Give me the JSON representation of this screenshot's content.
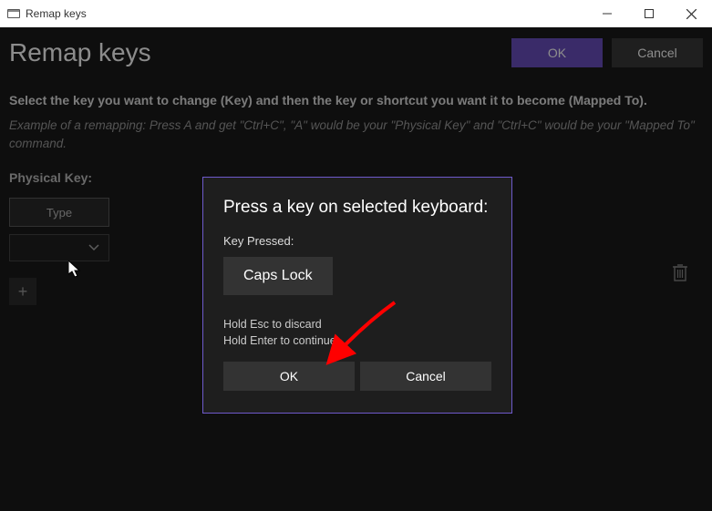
{
  "titlebar": {
    "title": "Remap keys"
  },
  "header": {
    "page_title": "Remap keys",
    "ok_label": "OK",
    "cancel_label": "Cancel"
  },
  "main": {
    "instruction": "Select the key you want to change (Key) and then the key or shortcut you want it to become (Mapped To).",
    "example": "Example of a remapping: Press A and get \"Ctrl+C\", \"A\" would be your \"Physical Key\" and \"Ctrl+C\" would be your \"Mapped To\" command.",
    "physical_key_label": "Physical Key:",
    "type_button_label": "Type",
    "select_value": "",
    "add_label": "+"
  },
  "modal": {
    "title": "Press a key on selected keyboard:",
    "key_pressed_label": "Key Pressed:",
    "key_pressed_value": "Caps Lock",
    "hint_line1": "Hold Esc to discard",
    "hint_line2": "Hold Enter to continue",
    "ok_label": "OK",
    "cancel_label": "Cancel"
  },
  "colors": {
    "accent": "#6b4fbf",
    "modal_border": "#6e5acb",
    "annotation_arrow": "#ff0000"
  }
}
